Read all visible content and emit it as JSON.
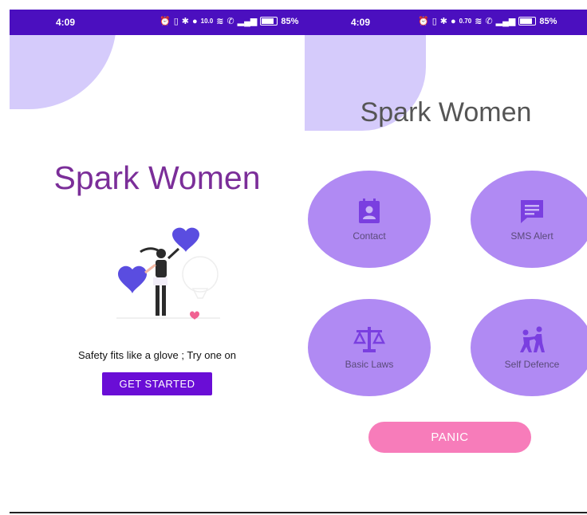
{
  "left_screen": {
    "status_bar": {
      "time": "4:09",
      "net_speed": "10.0",
      "battery": "85%"
    },
    "app_title": "Spark Women",
    "tagline": "Safety fits like a glove ; Try one on",
    "get_started_label": "GET STARTED"
  },
  "right_screen": {
    "status_bar": {
      "time": "4:09",
      "net_speed": "0.70",
      "battery": "85%"
    },
    "app_title": "Spark Women",
    "menu": [
      {
        "label": "Contact",
        "icon": "contact-book-icon"
      },
      {
        "label": "SMS Alert",
        "icon": "message-icon"
      },
      {
        "label": "Basic Laws",
        "icon": "scales-icon"
      },
      {
        "label": "Self Defence",
        "icon": "self-defence-icon"
      }
    ],
    "panic_label": "PANIC"
  },
  "colors": {
    "status_bar": "#4b0fbf",
    "title_purple": "#7b2e99",
    "button_purple": "#6a0dd6",
    "blob": "#d5cbfb",
    "circle": "#b08af3",
    "icon": "#7a3fe0",
    "panic": "#f77cba"
  }
}
